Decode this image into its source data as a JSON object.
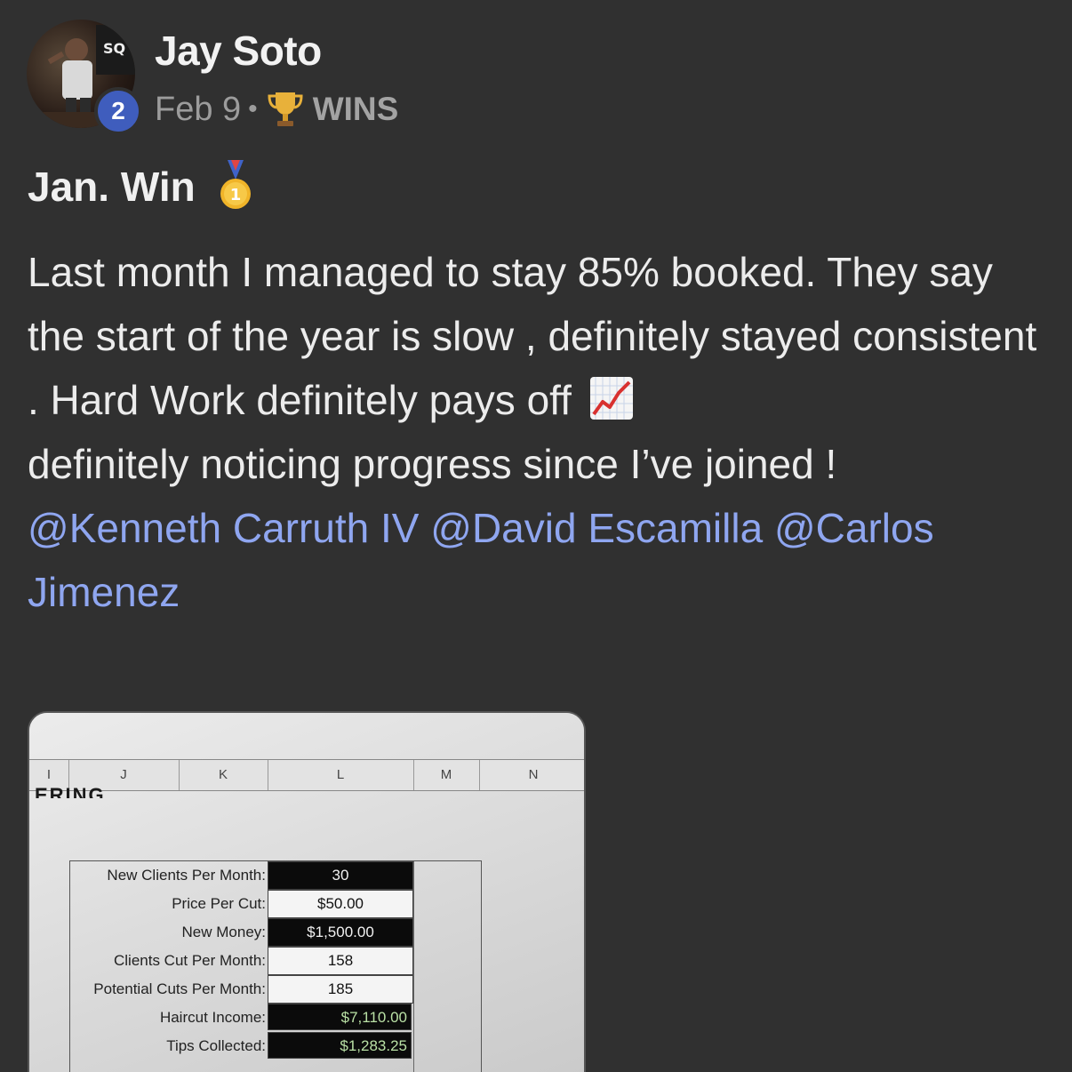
{
  "author": {
    "name": "Jay Soto",
    "level": "2"
  },
  "meta": {
    "date": "Feb 9",
    "separator": "•",
    "category": "WINS",
    "category_icon": "trophy-icon"
  },
  "post": {
    "title": "Jan. Win",
    "title_icon": "first-place-medal-icon",
    "body_line_1": "Last month I managed to stay 85% booked. They say the start of the year is slow , definitely stayed consistent . Hard Work definitely pays off",
    "body_icon": "chart-increasing-icon",
    "body_line_2": "definitely noticing progress since I’ve joined !",
    "mentions": [
      "@Kenneth Carruth IV",
      "@David Escamilla",
      "@Carlos Jimenez"
    ]
  },
  "attachment": {
    "columns": [
      "I",
      "J",
      "K",
      "L",
      "M",
      "N"
    ],
    "sheet_heading": "ERING",
    "rows": [
      {
        "label": "New Clients Per Month:",
        "value": "30"
      },
      {
        "label": "Price Per Cut:",
        "value": "$50.00"
      },
      {
        "label": "New Money:",
        "value": "$1,500.00"
      },
      {
        "label": "Clients Cut Per Month:",
        "value": "158"
      },
      {
        "label": "Potential Cuts Per Month:",
        "value": "185"
      },
      {
        "label": "Haircut Income:",
        "value": "$7,110.00"
      },
      {
        "label": "Tips Collected:",
        "value": "$1,283.25"
      }
    ]
  },
  "colors": {
    "background": "#303030",
    "mention": "#8fa6f0",
    "level_badge": "#3f5dbd"
  }
}
